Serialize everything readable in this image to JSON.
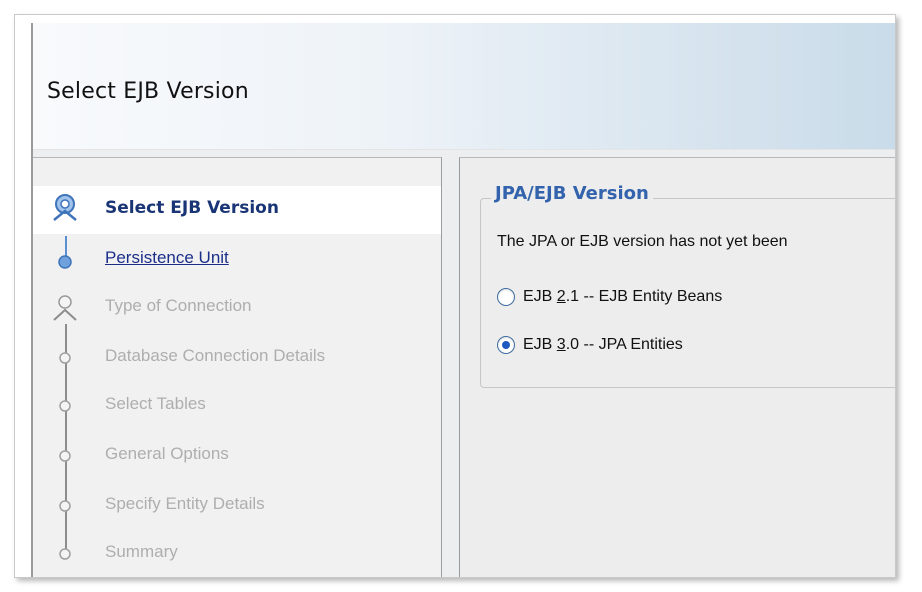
{
  "header": {
    "title": "Select EJB Version"
  },
  "steps": [
    {
      "label": "Select EJB Version",
      "state": "active"
    },
    {
      "label": "Persistence Unit",
      "state": "link"
    },
    {
      "label": "Type of Connection",
      "state": "disabled"
    },
    {
      "label": "Database Connection Details",
      "state": "disabled"
    },
    {
      "label": "Select Tables",
      "state": "disabled"
    },
    {
      "label": "General Options",
      "state": "disabled"
    },
    {
      "label": "Specify Entity Details",
      "state": "disabled"
    },
    {
      "label": "Summary",
      "state": "disabled"
    }
  ],
  "group": {
    "legend": "JPA/EJB Version",
    "description": "The JPA or EJB version has not yet been",
    "options": [
      {
        "prefix": "EJB ",
        "mnemonic": "2",
        "suffix": ".1 -- EJB Entity Beans",
        "checked": false
      },
      {
        "prefix": "EJB ",
        "mnemonic": "3",
        "suffix": ".0 -- JPA Entities",
        "checked": true
      }
    ]
  },
  "colors": {
    "accent": "#3363ad",
    "link": "#1b2f8a",
    "active_text": "#1a3576",
    "disabled_text": "#aeaeae"
  }
}
